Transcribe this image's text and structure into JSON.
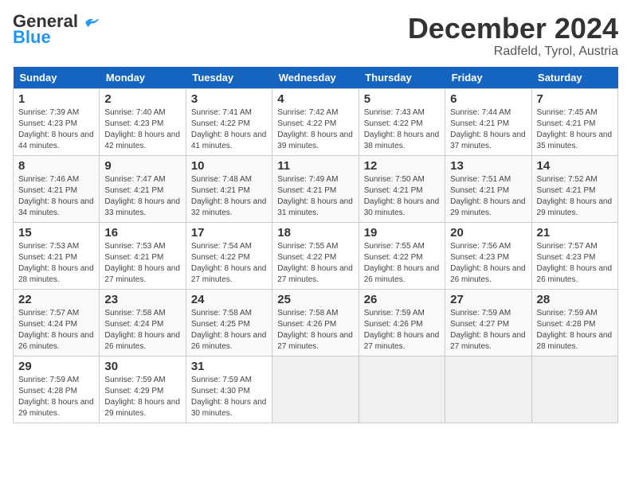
{
  "header": {
    "logo_line1": "General",
    "logo_line2": "Blue",
    "month": "December 2024",
    "location": "Radfeld, Tyrol, Austria"
  },
  "days_of_week": [
    "Sunday",
    "Monday",
    "Tuesday",
    "Wednesday",
    "Thursday",
    "Friday",
    "Saturday"
  ],
  "weeks": [
    [
      {
        "num": "1",
        "sunrise": "7:39 AM",
        "sunset": "4:23 PM",
        "daylight": "8 hours and 44 minutes."
      },
      {
        "num": "2",
        "sunrise": "7:40 AM",
        "sunset": "4:23 PM",
        "daylight": "8 hours and 42 minutes."
      },
      {
        "num": "3",
        "sunrise": "7:41 AM",
        "sunset": "4:22 PM",
        "daylight": "8 hours and 41 minutes."
      },
      {
        "num": "4",
        "sunrise": "7:42 AM",
        "sunset": "4:22 PM",
        "daylight": "8 hours and 39 minutes."
      },
      {
        "num": "5",
        "sunrise": "7:43 AM",
        "sunset": "4:22 PM",
        "daylight": "8 hours and 38 minutes."
      },
      {
        "num": "6",
        "sunrise": "7:44 AM",
        "sunset": "4:21 PM",
        "daylight": "8 hours and 37 minutes."
      },
      {
        "num": "7",
        "sunrise": "7:45 AM",
        "sunset": "4:21 PM",
        "daylight": "8 hours and 35 minutes."
      }
    ],
    [
      {
        "num": "8",
        "sunrise": "7:46 AM",
        "sunset": "4:21 PM",
        "daylight": "8 hours and 34 minutes."
      },
      {
        "num": "9",
        "sunrise": "7:47 AM",
        "sunset": "4:21 PM",
        "daylight": "8 hours and 33 minutes."
      },
      {
        "num": "10",
        "sunrise": "7:48 AM",
        "sunset": "4:21 PM",
        "daylight": "8 hours and 32 minutes."
      },
      {
        "num": "11",
        "sunrise": "7:49 AM",
        "sunset": "4:21 PM",
        "daylight": "8 hours and 31 minutes."
      },
      {
        "num": "12",
        "sunrise": "7:50 AM",
        "sunset": "4:21 PM",
        "daylight": "8 hours and 30 minutes."
      },
      {
        "num": "13",
        "sunrise": "7:51 AM",
        "sunset": "4:21 PM",
        "daylight": "8 hours and 29 minutes."
      },
      {
        "num": "14",
        "sunrise": "7:52 AM",
        "sunset": "4:21 PM",
        "daylight": "8 hours and 29 minutes."
      }
    ],
    [
      {
        "num": "15",
        "sunrise": "7:53 AM",
        "sunset": "4:21 PM",
        "daylight": "8 hours and 28 minutes."
      },
      {
        "num": "16",
        "sunrise": "7:53 AM",
        "sunset": "4:21 PM",
        "daylight": "8 hours and 27 minutes."
      },
      {
        "num": "17",
        "sunrise": "7:54 AM",
        "sunset": "4:22 PM",
        "daylight": "8 hours and 27 minutes."
      },
      {
        "num": "18",
        "sunrise": "7:55 AM",
        "sunset": "4:22 PM",
        "daylight": "8 hours and 27 minutes."
      },
      {
        "num": "19",
        "sunrise": "7:55 AM",
        "sunset": "4:22 PM",
        "daylight": "8 hours and 26 minutes."
      },
      {
        "num": "20",
        "sunrise": "7:56 AM",
        "sunset": "4:23 PM",
        "daylight": "8 hours and 26 minutes."
      },
      {
        "num": "21",
        "sunrise": "7:57 AM",
        "sunset": "4:23 PM",
        "daylight": "8 hours and 26 minutes."
      }
    ],
    [
      {
        "num": "22",
        "sunrise": "7:57 AM",
        "sunset": "4:24 PM",
        "daylight": "8 hours and 26 minutes."
      },
      {
        "num": "23",
        "sunrise": "7:58 AM",
        "sunset": "4:24 PM",
        "daylight": "8 hours and 26 minutes."
      },
      {
        "num": "24",
        "sunrise": "7:58 AM",
        "sunset": "4:25 PM",
        "daylight": "8 hours and 26 minutes."
      },
      {
        "num": "25",
        "sunrise": "7:58 AM",
        "sunset": "4:26 PM",
        "daylight": "8 hours and 27 minutes."
      },
      {
        "num": "26",
        "sunrise": "7:59 AM",
        "sunset": "4:26 PM",
        "daylight": "8 hours and 27 minutes."
      },
      {
        "num": "27",
        "sunrise": "7:59 AM",
        "sunset": "4:27 PM",
        "daylight": "8 hours and 27 minutes."
      },
      {
        "num": "28",
        "sunrise": "7:59 AM",
        "sunset": "4:28 PM",
        "daylight": "8 hours and 28 minutes."
      }
    ],
    [
      {
        "num": "29",
        "sunrise": "7:59 AM",
        "sunset": "4:28 PM",
        "daylight": "8 hours and 29 minutes."
      },
      {
        "num": "30",
        "sunrise": "7:59 AM",
        "sunset": "4:29 PM",
        "daylight": "8 hours and 29 minutes."
      },
      {
        "num": "31",
        "sunrise": "7:59 AM",
        "sunset": "4:30 PM",
        "daylight": "8 hours and 30 minutes."
      },
      null,
      null,
      null,
      null
    ]
  ]
}
